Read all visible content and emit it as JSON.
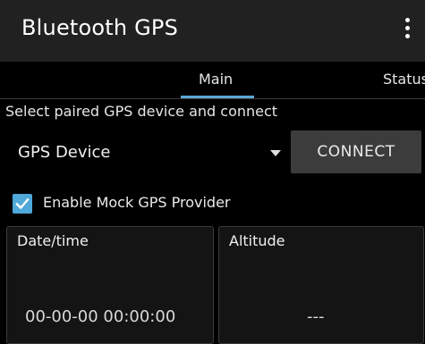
{
  "app": {
    "title": "Bluetooth GPS",
    "menu_icon": "more-vert-icon"
  },
  "tabs": [
    {
      "label": "Main",
      "selected": true
    },
    {
      "label": "Status",
      "selected": false
    }
  ],
  "main": {
    "instructions": "Select paired GPS device and connect",
    "device_select": {
      "value": "GPS Device"
    },
    "connect_label": "CONNECT",
    "mock_provider": {
      "label": "Enable Mock GPS Provider",
      "checked": true
    },
    "cards": {
      "datetime": {
        "label": "Date/time",
        "value": "00-00-00 00:00:00"
      },
      "altitude": {
        "label": "Altitude",
        "value": "---"
      }
    }
  },
  "colors": {
    "accent": "#5aa9d6",
    "appbar": "#212121",
    "background": "#000000",
    "button": "#3c3c3c"
  }
}
